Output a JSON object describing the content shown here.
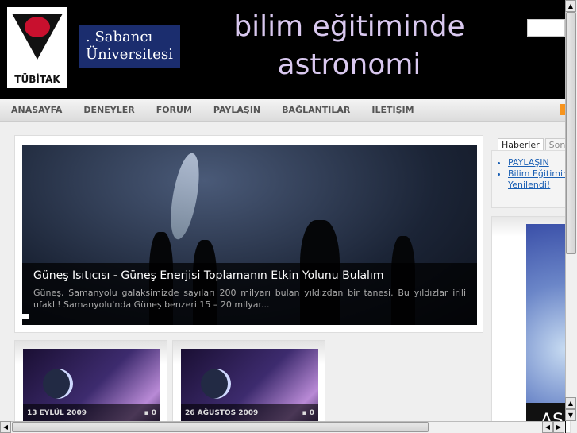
{
  "header": {
    "logo_text": "TÜBİTAK",
    "sponsor_logo": ". Sabancı Üniversitesi",
    "site_title_line1": "bilim eğitiminde",
    "site_title_line2": "astronomi",
    "search_placeholder": ""
  },
  "nav": {
    "items": [
      "ANASAYFA",
      "DENEYLER",
      "FORUM",
      "PAYLAŞIN",
      "BAĞLANTILAR",
      "ILETIŞIM"
    ]
  },
  "slider": {
    "title": "Güneş Isıtıcısı - Güneş Enerjisi Toplamanın Etkin Yolunu Bulalım",
    "excerpt": "Güneş, Samanyolu galaksimizde sayıları 200 milyarı bulan yıldızdan bir tanesi. Bu yıldızlar irili ufaklı! Samanyolu'nda Güneş benzeri 15 – 20 milyar..."
  },
  "cards": [
    {
      "date": "13 EYLÜL 2009",
      "comments": "0"
    },
    {
      "date": "26 AĞUSTOS 2009",
      "comments": "0"
    }
  ],
  "sidebar": {
    "tabs": [
      "Haberler",
      "Son"
    ],
    "news": [
      "PAYLAŞIN",
      "Bilim Eğitimin Yenilendi!"
    ],
    "ad_text": "AS"
  },
  "colors": {
    "header_bg": "#000000",
    "link": "#1a5fb4",
    "title": "#d9c8ef"
  }
}
